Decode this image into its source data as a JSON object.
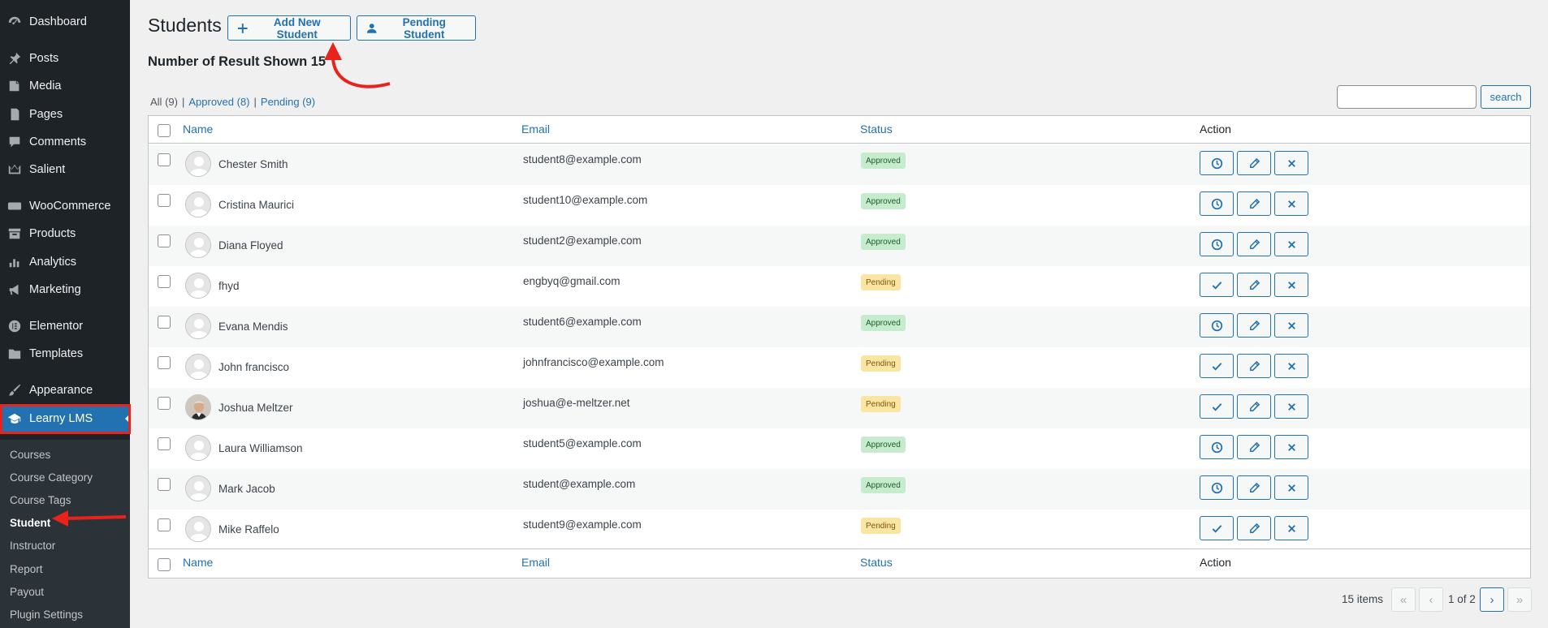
{
  "sidebar": {
    "items": [
      {
        "label": "Dashboard",
        "icon": "dashboard-icon"
      },
      {
        "label": "Posts",
        "icon": "pin-icon"
      },
      {
        "label": "Media",
        "icon": "media-icon"
      },
      {
        "label": "Pages",
        "icon": "pages-icon"
      },
      {
        "label": "Comments",
        "icon": "comment-icon"
      },
      {
        "label": "Salient",
        "icon": "crown-icon"
      },
      {
        "label": "WooCommerce",
        "icon": "woo-icon"
      },
      {
        "label": "Products",
        "icon": "archive-icon"
      },
      {
        "label": "Analytics",
        "icon": "bar-chart-icon"
      },
      {
        "label": "Marketing",
        "icon": "megaphone-icon"
      },
      {
        "label": "Elementor",
        "icon": "elementor-icon"
      },
      {
        "label": "Templates",
        "icon": "folder-icon"
      },
      {
        "label": "Appearance",
        "icon": "brush-icon"
      },
      {
        "label": "Learny LMS",
        "icon": "graduation-cap-icon"
      }
    ],
    "submenu": [
      "Courses",
      "Course Category",
      "Course Tags",
      "Student",
      "Instructor",
      "Report",
      "Payout",
      "Plugin Settings"
    ],
    "current_submenu": "Student"
  },
  "header": {
    "title": "Students",
    "add_button": "Add New Student",
    "pending_button": "Pending Student",
    "results": "Number of Result Shown 15"
  },
  "filters": {
    "all": "All",
    "all_count": "(9)",
    "approved": "Approved (8)",
    "pending": "Pending (9)",
    "separator": "|"
  },
  "search": {
    "button": "search",
    "placeholder": ""
  },
  "columns": {
    "name": "Name",
    "email": "Email",
    "status": "Status",
    "action": "Action"
  },
  "rows": [
    {
      "name": "Chester Smith",
      "email": "student8@example.com",
      "status": "Approved"
    },
    {
      "name": "Cristina Maurici",
      "email": "student10@example.com",
      "status": "Approved"
    },
    {
      "name": "Diana Floyed",
      "email": "student2@example.com",
      "status": "Approved"
    },
    {
      "name": "fhyd",
      "email": "engbyq@gmail.com",
      "status": "Pending"
    },
    {
      "name": "Evana Mendis",
      "email": "student6@example.com",
      "status": "Approved"
    },
    {
      "name": "John francisco",
      "email": "johnfrancisco@example.com",
      "status": "Pending"
    },
    {
      "name": "Joshua Meltzer",
      "email": "joshua@e-meltzer.net",
      "status": "Pending"
    },
    {
      "name": "Laura Williamson",
      "email": "student5@example.com",
      "status": "Approved"
    },
    {
      "name": "Mark Jacob",
      "email": "student@example.com",
      "status": "Approved"
    },
    {
      "name": "Mike Raffelo",
      "email": "student9@example.com",
      "status": "Pending"
    }
  ],
  "pagination": {
    "items": "15 items",
    "first": "«",
    "prev": "‹",
    "page": "1 of 2",
    "next": "›",
    "last": "»"
  },
  "colors": {
    "accent": "#2271b1",
    "sidebar": "#1d2327",
    "annotation": "#e8231b"
  }
}
